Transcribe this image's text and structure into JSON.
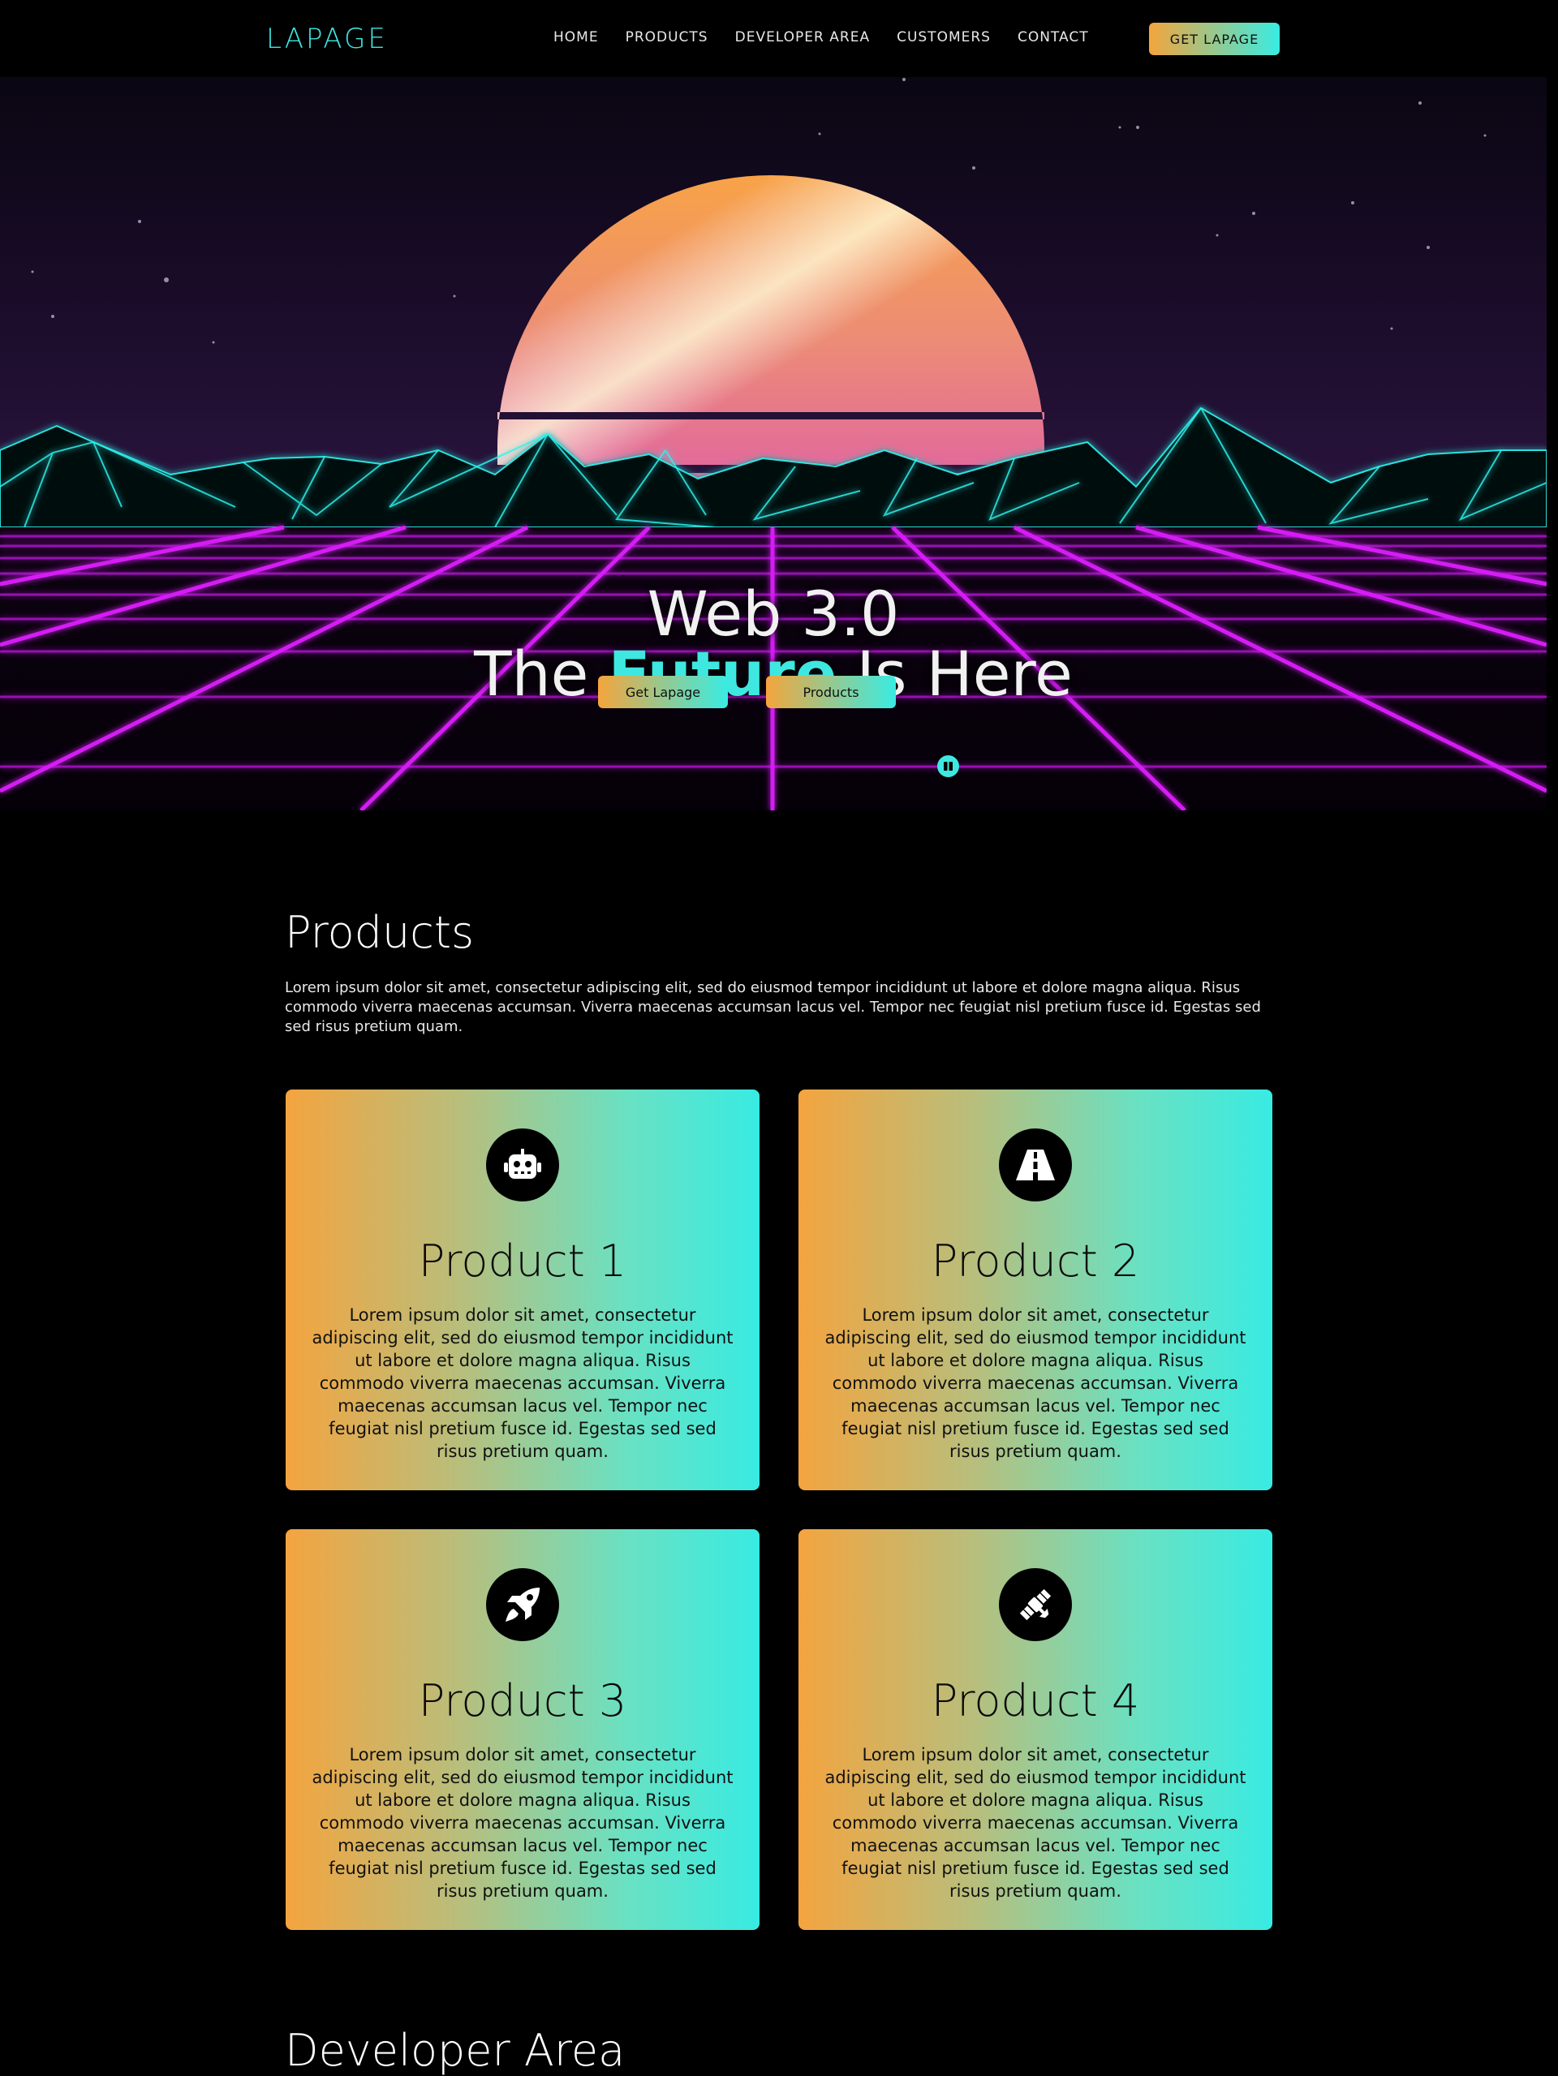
{
  "nav": {
    "logo": "LAPAGE",
    "links": [
      "HOME",
      "PRODUCTS",
      "DEVELOPER AREA",
      "CUSTOMERS",
      "CONTACT"
    ],
    "cta": "GET LAPAGE"
  },
  "hero": {
    "line1": "Web 3.0",
    "line2_pre": "The",
    "line2_accent": "Future",
    "line2_post": "Is Here",
    "btn_primary": "Get Lapage",
    "btn_secondary": "Products"
  },
  "products": {
    "title": "Products",
    "intro": "Lorem ipsum dolor sit amet, consectetur adipiscing elit, sed do eiusmod tempor incididunt ut labore et dolore magna aliqua. Risus commodo viverra maecenas accumsan. Viverra maecenas accumsan lacus vel. Tempor nec feugiat nisl pretium fusce id. Egestas sed sed risus pretium quam.",
    "cards": [
      {
        "title": "Product 1",
        "icon": "robot-icon",
        "text": "Lorem ipsum dolor sit amet, consectetur adipiscing elit, sed do eiusmod tempor incididunt ut labore et dolore magna aliqua. Risus commodo viverra maecenas accumsan. Viverra maecenas accumsan lacus vel. Tempor nec feugiat nisl pretium fusce id. Egestas sed sed risus pretium quam."
      },
      {
        "title": "Product 2",
        "icon": "road-icon",
        "text": "Lorem ipsum dolor sit amet, consectetur adipiscing elit, sed do eiusmod tempor incididunt ut labore et dolore magna aliqua. Risus commodo viverra maecenas accumsan. Viverra maecenas accumsan lacus vel. Tempor nec feugiat nisl pretium fusce id. Egestas sed sed risus pretium quam."
      },
      {
        "title": "Product 3",
        "icon": "rocket-icon",
        "text": "Lorem ipsum dolor sit amet, consectetur adipiscing elit, sed do eiusmod tempor incididunt ut labore et dolore magna aliqua. Risus commodo viverra maecenas accumsan. Viverra maecenas accumsan lacus vel. Tempor nec feugiat nisl pretium fusce id. Egestas sed sed risus pretium quam."
      },
      {
        "title": "Product 4",
        "icon": "satellite-icon",
        "text": "Lorem ipsum dolor sit amet, consectetur adipiscing elit, sed do eiusmod tempor incididunt ut labore et dolore magna aliqua. Risus commodo viverra maecenas accumsan. Viverra maecenas accumsan lacus vel. Tempor nec feugiat nisl pretium fusce id. Egestas sed sed risus pretium quam."
      }
    ]
  },
  "next_section": {
    "title": "Developer Area"
  },
  "colors": {
    "accent": "#3ee8e0",
    "orange": "#f4a53c",
    "grid": "#d51df5",
    "mountain": "#2ff3ee"
  }
}
